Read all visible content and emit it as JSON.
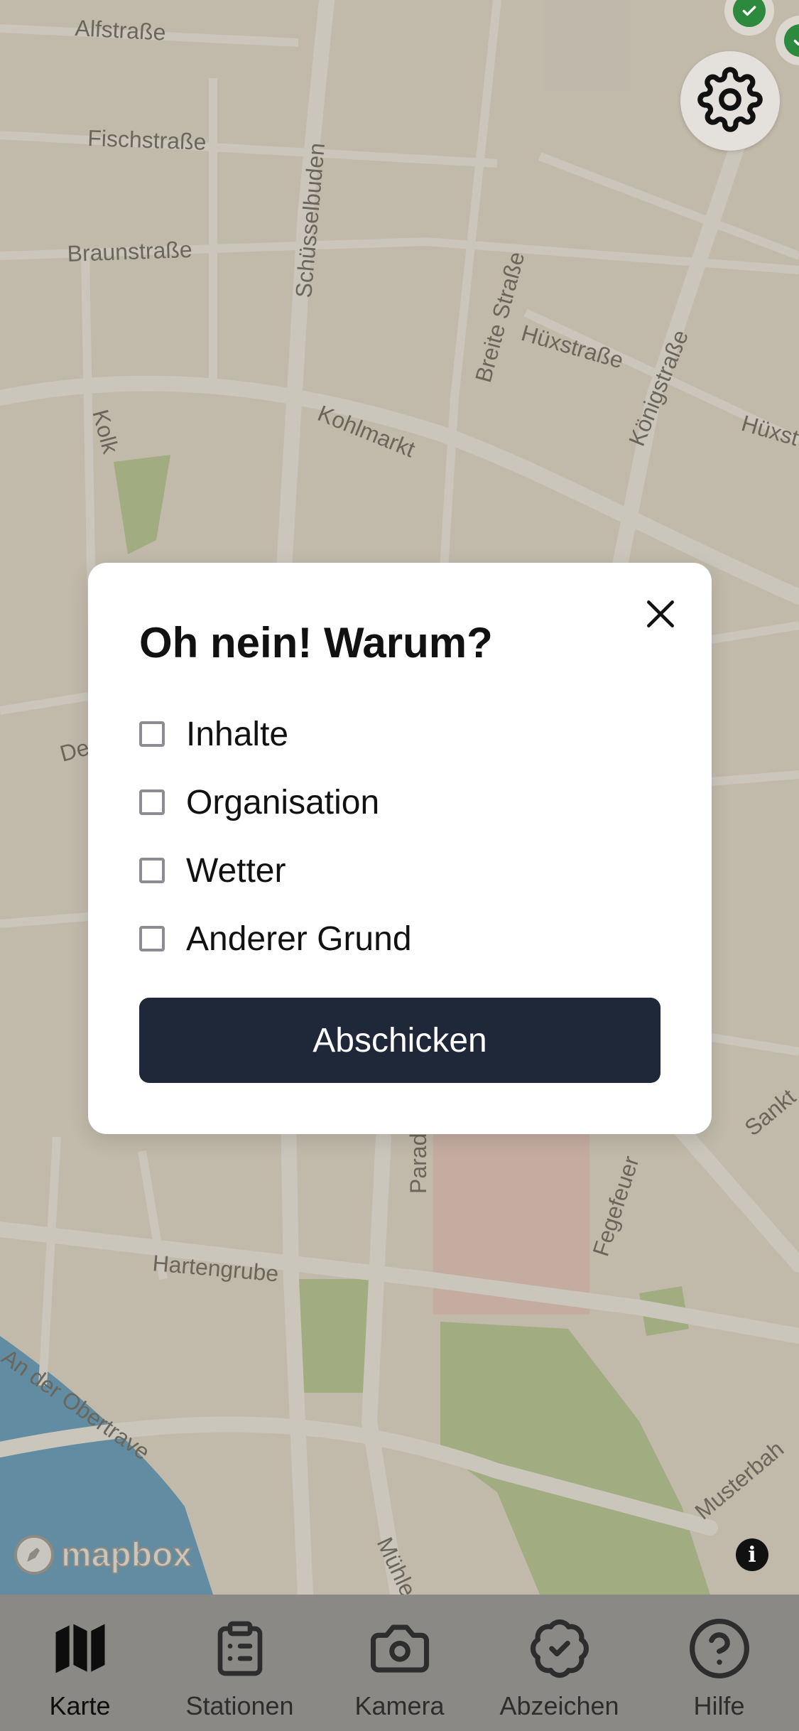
{
  "map": {
    "streets": [
      "Alfstraße",
      "Fischstraße",
      "Braunstraße",
      "Schüsselbuden",
      "Breite Straße",
      "Hüxstraße",
      "Königstraße",
      "Hüxst",
      "Kolk",
      "Kohlmarkt",
      "De",
      "Parad",
      "Fegefeuer",
      "Hartengrube",
      "An der Obertrave",
      "Mühle",
      "Musterbah",
      "Sankt"
    ],
    "attribution": "mapbox",
    "colors": {
      "land": "#efeae2",
      "road": "#ffffff",
      "park": "#b9d59a",
      "water": "#4b9bd1",
      "building": "#f4d3cf"
    }
  },
  "settings": {
    "icon": "gear-icon"
  },
  "modal": {
    "title": "Oh nein! Warum?",
    "close_icon": "close-icon",
    "options": [
      {
        "label": "Inhalte",
        "checked": false
      },
      {
        "label": "Organisation",
        "checked": false
      },
      {
        "label": "Wetter",
        "checked": false
      },
      {
        "label": "Anderer Grund",
        "checked": false
      }
    ],
    "submit_label": "Abschicken",
    "submit_color": "#1e2838"
  },
  "tabbar": {
    "items": [
      {
        "label": "Karte",
        "icon": "map-icon",
        "active": true
      },
      {
        "label": "Stationen",
        "icon": "clipboard-list-icon",
        "active": false
      },
      {
        "label": "Kamera",
        "icon": "camera-icon",
        "active": false
      },
      {
        "label": "Abzeichen",
        "icon": "badge-check-icon",
        "active": false
      },
      {
        "label": "Hilfe",
        "icon": "help-circle-icon",
        "active": false
      }
    ]
  }
}
